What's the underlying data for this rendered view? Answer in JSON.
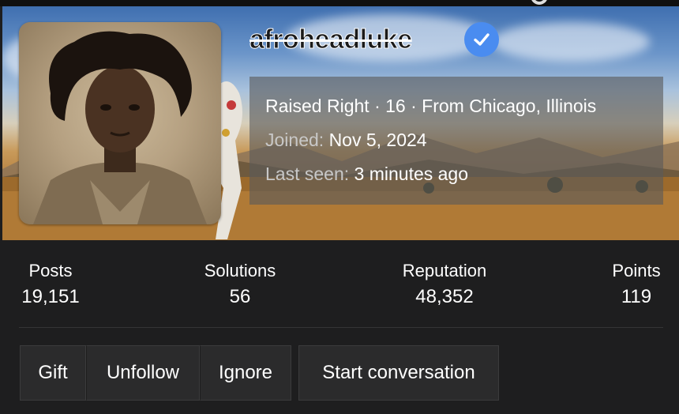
{
  "profile": {
    "username": "afroheadluke",
    "verified_icon": "verified-check-icon",
    "title_line": "Raised Right · 16 · From Chicago, Illinois",
    "joined_label": "Joined:",
    "joined_value": "Nov 5, 2024",
    "last_seen_label": "Last seen:",
    "last_seen_value": "3 minutes ago"
  },
  "stats": [
    {
      "label": "Posts",
      "value": "19,151"
    },
    {
      "label": "Solutions",
      "value": "56"
    },
    {
      "label": "Reputation",
      "value": "48,352"
    },
    {
      "label": "Points",
      "value": "119"
    }
  ],
  "actions": {
    "gift": "Gift",
    "unfollow": "Unfollow",
    "ignore": "Ignore",
    "start_conversation": "Start conversation"
  },
  "colors": {
    "background": "#1e1e1f",
    "button_bg": "#2b2b2c",
    "verified_blue": "#4a8cf0",
    "text": "#ffffff",
    "muted_text": "#c8c8c8"
  }
}
